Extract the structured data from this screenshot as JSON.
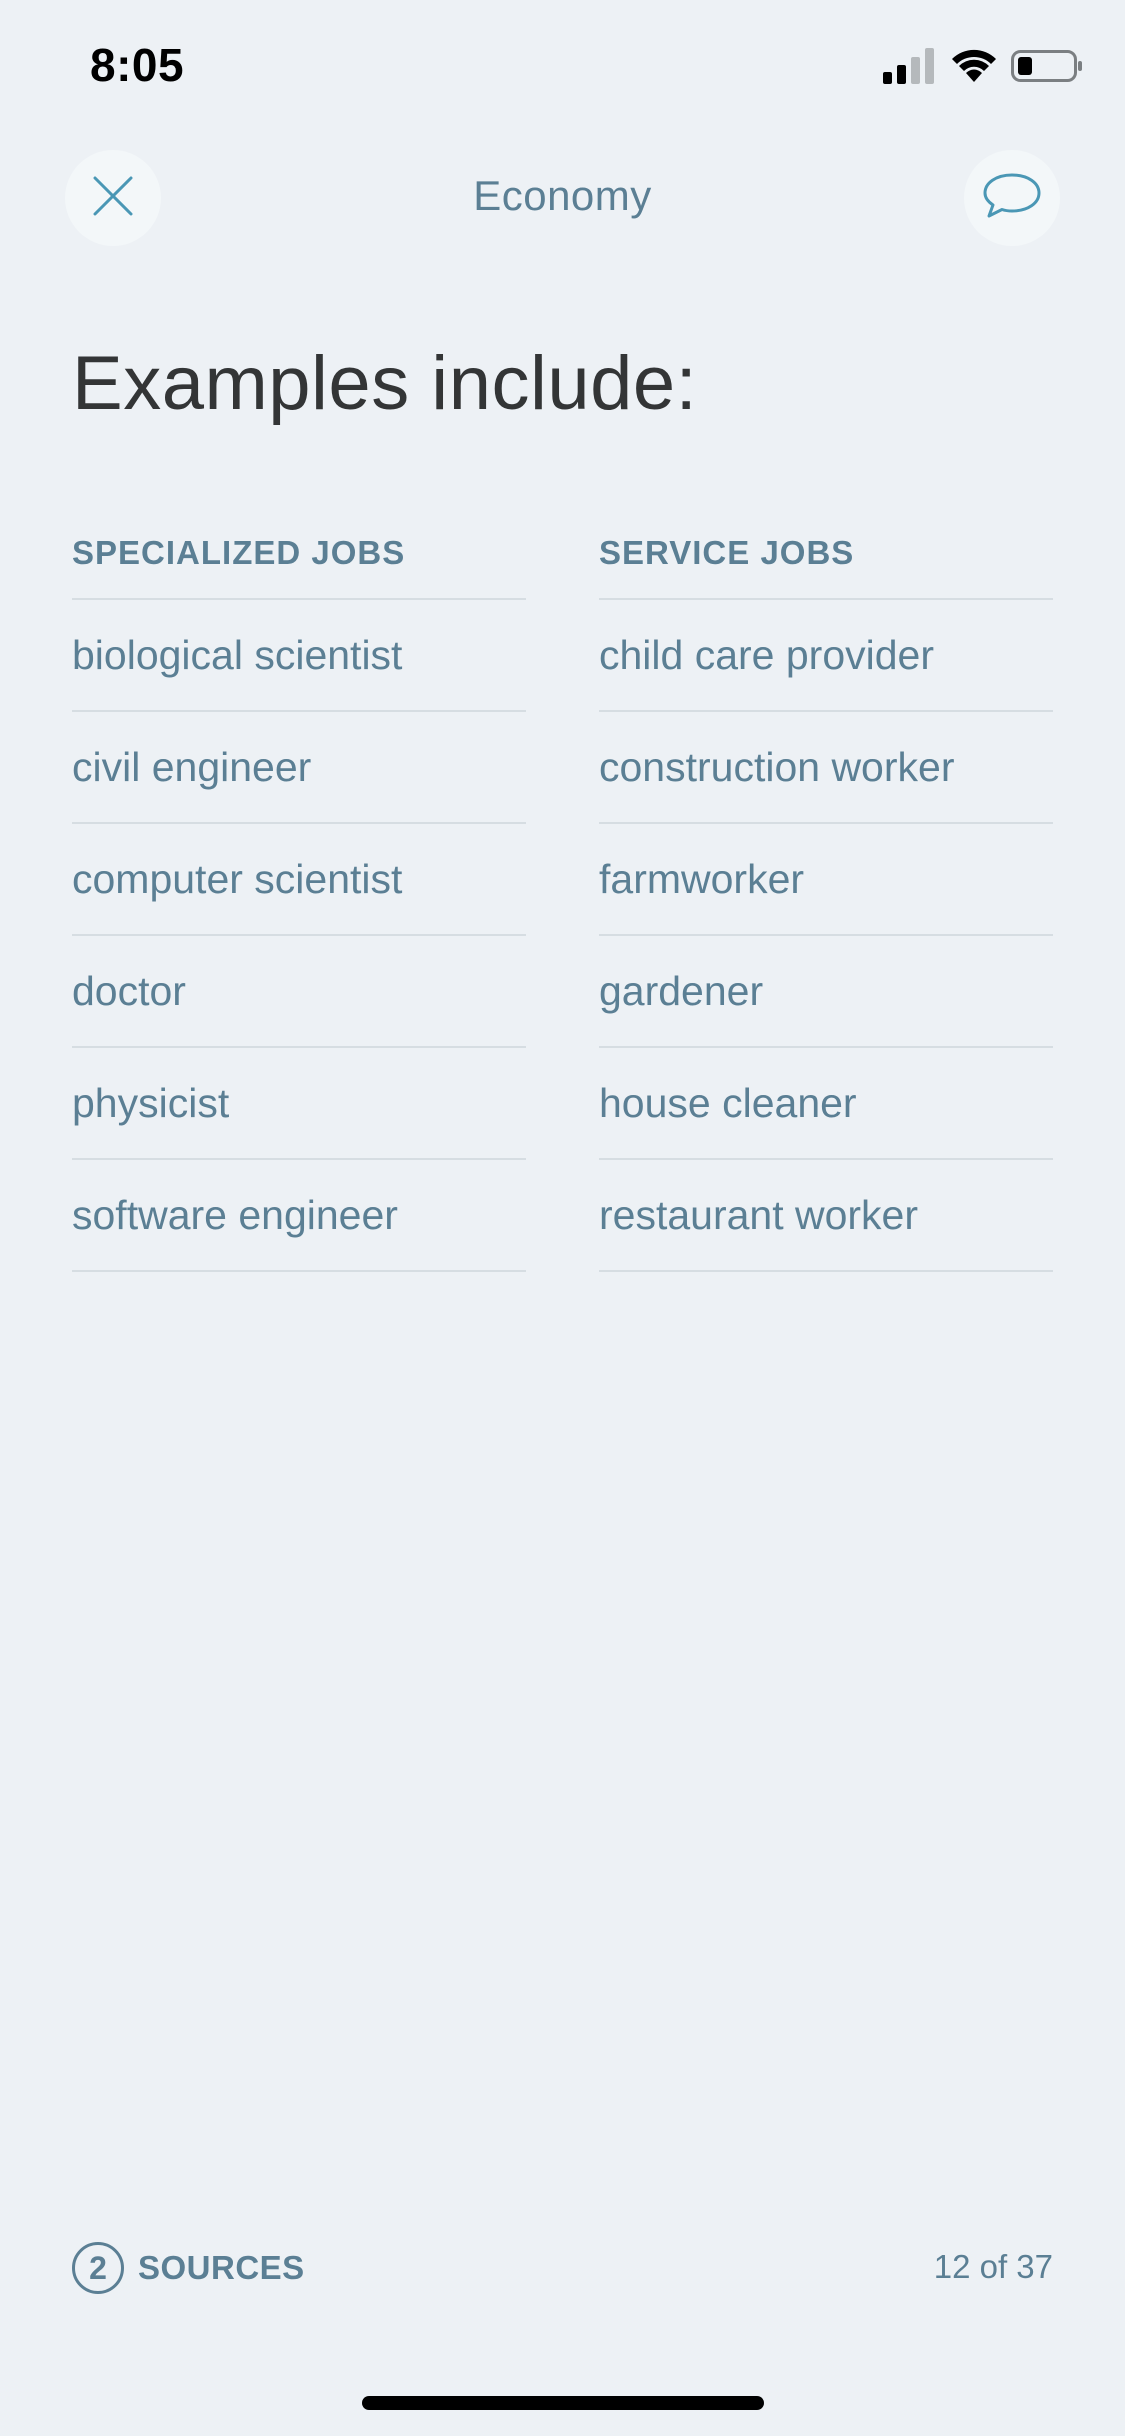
{
  "status_bar": {
    "time": "8:05"
  },
  "header": {
    "title": "Economy",
    "close_icon": "close-icon",
    "chat_icon": "speech-bubble-icon"
  },
  "content": {
    "heading": "Examples include:",
    "columns": [
      {
        "title": "SPECIALIZED JOBS",
        "items": [
          "biological scientist",
          "civil engineer",
          "computer scientist",
          "doctor",
          "physicist",
          "software engineer"
        ]
      },
      {
        "title": "SERVICE JOBS",
        "items": [
          "child care provider",
          "construction worker",
          "farmworker",
          "gardener",
          "house cleaner",
          "restaurant worker"
        ]
      }
    ]
  },
  "footer": {
    "sources_count": "2",
    "sources_label": "SOURCES",
    "page_counter": "12 of 37"
  },
  "colors": {
    "background": "#edf1f5",
    "accent": "#5b7f94",
    "icon_blue": "#4a97b5",
    "heading": "#333536",
    "divider": "#d6dde2"
  }
}
